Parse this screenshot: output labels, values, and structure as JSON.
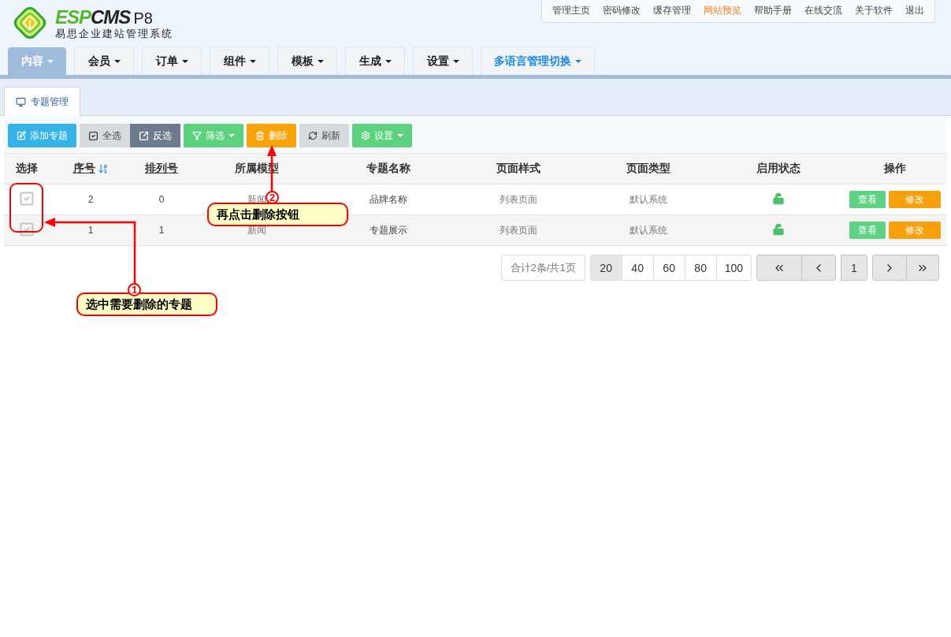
{
  "logo": {
    "brand_primary": "ESP",
    "brand_secondary": "CMS",
    "version": "P8",
    "subtitle": "易思企业建站管理系统"
  },
  "top_links": [
    {
      "label": "管理主页",
      "highlighted": false
    },
    {
      "label": "密码修改",
      "highlighted": false
    },
    {
      "label": "缓存管理",
      "highlighted": false
    },
    {
      "label": "网站预览",
      "highlighted": true
    },
    {
      "label": "帮助手册",
      "highlighted": false
    },
    {
      "label": "在线交流",
      "highlighted": false
    },
    {
      "label": "关于软件",
      "highlighted": false
    },
    {
      "label": "退出",
      "highlighted": false
    }
  ],
  "nav_tabs": [
    {
      "label": "内容",
      "selected": true,
      "accent": false
    },
    {
      "label": "会员",
      "selected": false,
      "accent": false
    },
    {
      "label": "订单",
      "selected": false,
      "accent": false
    },
    {
      "label": "组件",
      "selected": false,
      "accent": false
    },
    {
      "label": "模板",
      "selected": false,
      "accent": false
    },
    {
      "label": "生成",
      "selected": false,
      "accent": false
    },
    {
      "label": "设置",
      "selected": false,
      "accent": false
    },
    {
      "label": "多语言管理切换",
      "selected": false,
      "accent": true
    }
  ],
  "page_tabs": [
    {
      "label": "专题管理",
      "selected": true
    }
  ],
  "toolbar": [
    {
      "kind": "info",
      "label": "添加专题",
      "dropdown": false
    },
    {
      "kind": "group",
      "buttons": [
        {
          "kind": "light",
          "label": "全选",
          "dropdown": false
        },
        {
          "kind": "dark",
          "label": "反选",
          "dropdown": false
        }
      ]
    },
    {
      "kind": "success",
      "label": "筛选",
      "dropdown": true
    },
    {
      "kind": "warning",
      "label": "删除",
      "dropdown": false
    },
    {
      "kind": "light",
      "label": "刷新",
      "dropdown": false
    },
    {
      "kind": "success",
      "label": "设置",
      "dropdown": true
    }
  ],
  "table": {
    "columns": [
      {
        "label": "选择",
        "linked": false,
        "sorted": false
      },
      {
        "label": "序号",
        "linked": true,
        "sorted": true
      },
      {
        "label": "排列号",
        "linked": true,
        "sorted": false
      },
      {
        "label": "所属模型",
        "linked": false,
        "sorted": false
      },
      {
        "label": "专题名称",
        "linked": false,
        "sorted": false
      },
      {
        "label": "页面样式",
        "linked": false,
        "sorted": false
      },
      {
        "label": "页面类型",
        "linked": false,
        "sorted": false
      },
      {
        "label": "启用状态",
        "linked": false,
        "sorted": false
      },
      {
        "label": "操作",
        "linked": false,
        "sorted": false
      }
    ],
    "rows": [
      {
        "checked": false,
        "id": "2",
        "sort": "0",
        "model": "新闻",
        "name": "品牌名称",
        "style": "列表页面",
        "type": "默认系统",
        "enabled": true,
        "actions": [
          "查看",
          "修改"
        ]
      },
      {
        "checked": false,
        "id": "1",
        "sort": "1",
        "model": "新闻",
        "name": "专题展示",
        "style": "列表页面",
        "type": "默认系统",
        "enabled": true,
        "actions": [
          "查看",
          "修改"
        ]
      }
    ]
  },
  "pagination": {
    "summary": "合计2条/共1页",
    "page_sizes": [
      {
        "label": "20",
        "selected": true
      },
      {
        "label": "40",
        "selected": false
      },
      {
        "label": "60",
        "selected": false
      },
      {
        "label": "80",
        "selected": false
      },
      {
        "label": "100",
        "selected": false
      }
    ],
    "pages": [
      {
        "label": "1"
      }
    ]
  },
  "annotations": [
    {
      "number": "1",
      "text": "选中需要删除的专题"
    },
    {
      "number": "2",
      "text": "再点击删除按钮"
    }
  ]
}
